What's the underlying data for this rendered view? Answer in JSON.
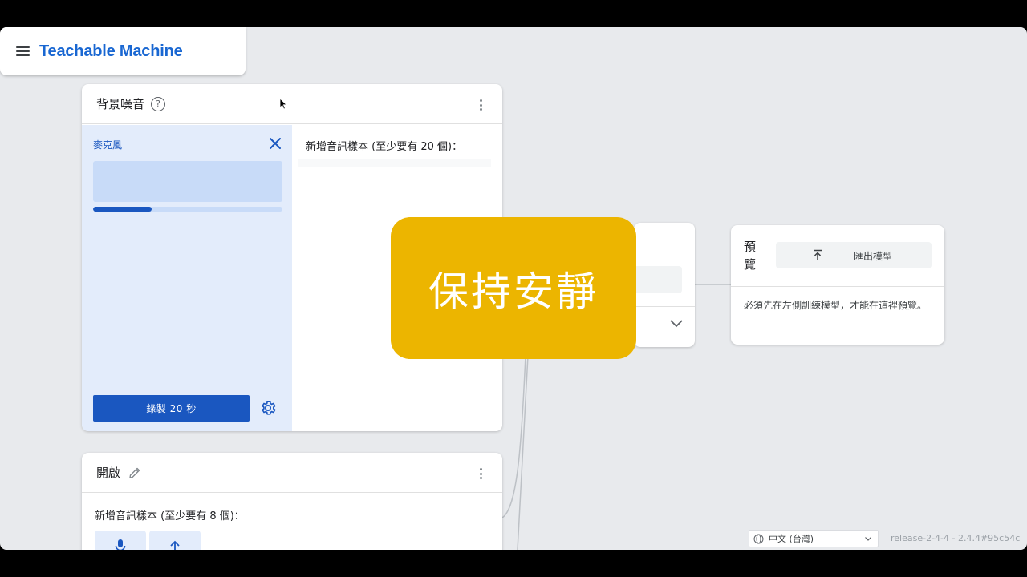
{
  "app": {
    "title": "Teachable Machine"
  },
  "background_card": {
    "title": "背景噪音",
    "mic_label": "麥克風",
    "record_button": "錄製 20 秒",
    "samples_label": "新增音訊樣本 (至少要有 20 個)：",
    "record_progress": 0.31
  },
  "open_card": {
    "title": "開啟",
    "samples_label": "新增音訊樣本 (至少要有 8 個)："
  },
  "overlay": {
    "text": "保持安靜",
    "color": "#ecb500"
  },
  "preview_card": {
    "title": "預覽",
    "export_button": "匯出模型",
    "message": "必須先在左側訓練模型，才能在這裡預覽。"
  },
  "footer": {
    "language": "中文 (台灣)",
    "version": "release-2-4-4 - 2.4.4#95c54c"
  },
  "colors": {
    "accent": "#1a57c0",
    "brand": "#1967d2",
    "canvas": "#e8eaed"
  }
}
